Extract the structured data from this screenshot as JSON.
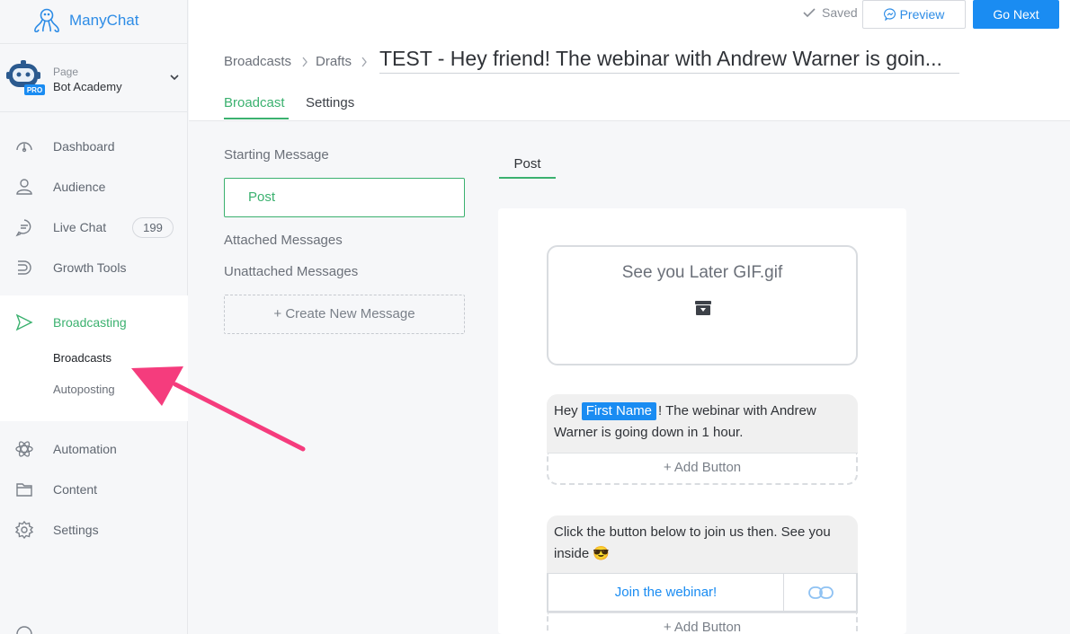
{
  "app": {
    "name": "ManyChat"
  },
  "page_switcher": {
    "label": "Page",
    "name": "Bot Academy",
    "badge": "PRO"
  },
  "sidebar": {
    "items": [
      {
        "label": "Dashboard",
        "icon": "dashboard-icon"
      },
      {
        "label": "Audience",
        "icon": "user-icon"
      },
      {
        "label": "Live Chat",
        "icon": "chat-bubble-icon",
        "count": "199"
      },
      {
        "label": "Growth Tools",
        "icon": "magnet-icon"
      },
      {
        "label": "Broadcasting",
        "icon": "send-icon",
        "active": true
      },
      {
        "label": "Automation",
        "icon": "atom-icon"
      },
      {
        "label": "Content",
        "icon": "folder-icon"
      },
      {
        "label": "Settings",
        "icon": "gear-icon"
      }
    ],
    "broadcasting_sub": [
      "Broadcasts",
      "Autoposting"
    ]
  },
  "topbar": {
    "saved_label": "Saved",
    "preview_label": "Preview",
    "go_next_label": "Go Next",
    "breadcrumbs": [
      "Broadcasts",
      "Drafts"
    ],
    "title": "TEST - Hey friend! The webinar with Andrew Warner is goin...",
    "tabs": [
      "Broadcast",
      "Settings"
    ],
    "active_tab": "Broadcast"
  },
  "messages_panel": {
    "starting_heading": "Starting Message",
    "starting_item": "Post",
    "attached_heading": "Attached Messages",
    "unattached_heading": "Unattached Messages",
    "create_label": "+ Create New Message"
  },
  "editor": {
    "tab": "Post",
    "gif_name": "See you Later GIF.gif",
    "msg1_prefix": "Hey",
    "msg1_chip": "First Name",
    "msg1_suffix": "! The webinar with Andrew Warner is going down in 1 hour.",
    "add_button_label": "+ Add Button",
    "msg2_text": "Click the button below to join us then. See you inside 😎",
    "button_label": "Join the webinar!"
  },
  "colors": {
    "brand_blue": "#1a8cf2",
    "active_green": "#3bb16f",
    "arrow_pink": "#f53c7d"
  }
}
